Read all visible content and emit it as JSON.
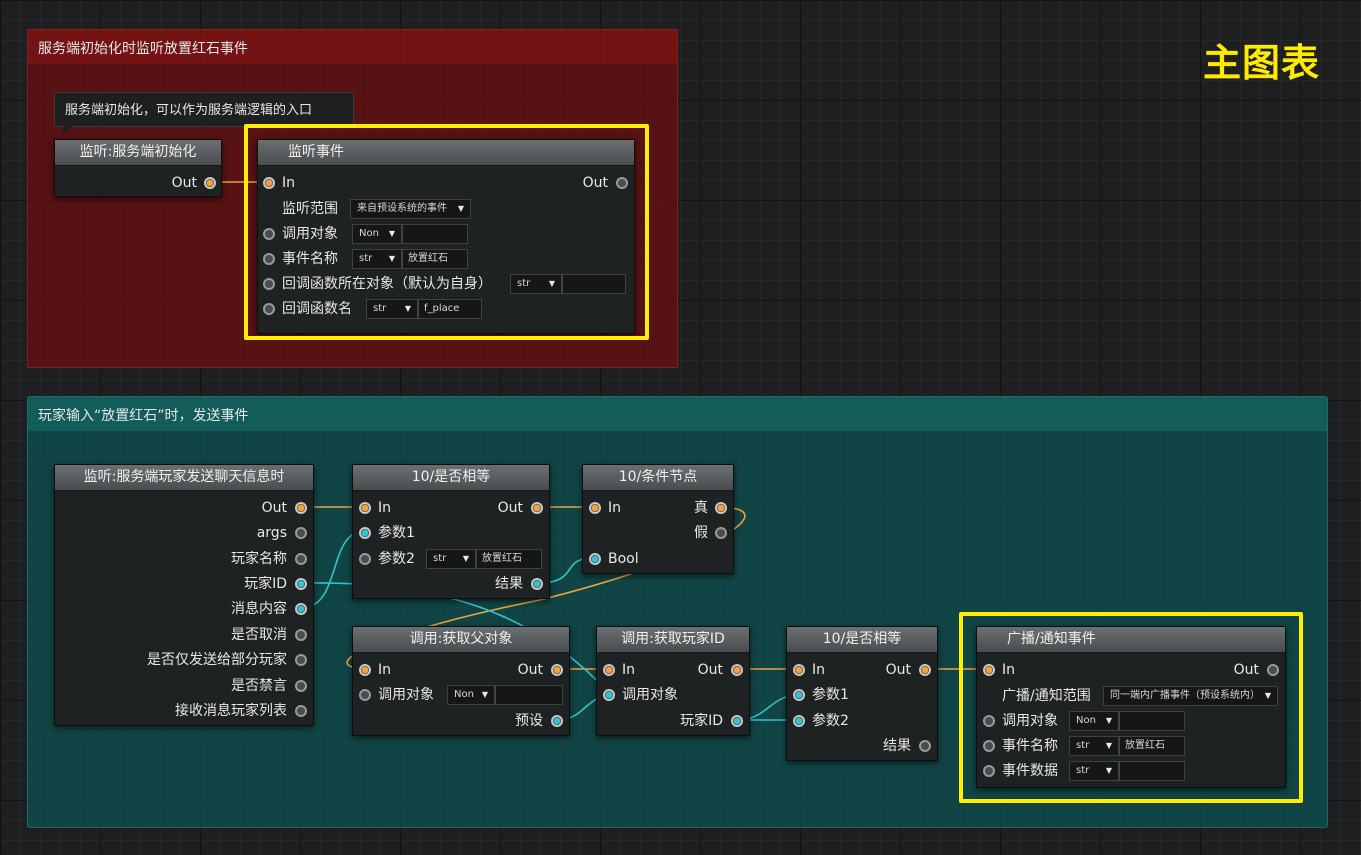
{
  "page_title": "主图表",
  "groups": {
    "server_init": {
      "title": "服务端初始化时监听放置红石事件"
    },
    "player_input": {
      "title": "玩家输入“放置红石”时，发送事件"
    }
  },
  "comment": {
    "text": "服务端初始化，可以作为服务端逻辑的入口"
  },
  "colors": {
    "exec_wire": "#f0a040",
    "data_wire": "#35c2d0",
    "highlight": "#ffee00",
    "group_red": "#6e0e0e",
    "group_teal": "#0e5250"
  },
  "nodes": {
    "server_init": {
      "title": "监听:服务端初始化",
      "out": "Out"
    },
    "listen_event": {
      "title": "监听事件",
      "in": "In",
      "out": "Out",
      "scope_label": "监听范围",
      "scope_value": "来自预设系统的事件",
      "target_label": "调用对象",
      "target_type": "Non",
      "event_name_label": "事件名称",
      "event_name_type": "str",
      "event_name_value": "放置红石",
      "callback_obj_label": "回调函数所在对象（默认为自身）",
      "callback_obj_type": "str",
      "callback_obj_value": "",
      "callback_name_label": "回调函数名",
      "callback_name_type": "str",
      "callback_name_value": "f_place"
    },
    "chat_listener": {
      "title": "监听:服务端玩家发送聊天信息时",
      "pins": [
        "Out",
        "args",
        "玩家名称",
        "玩家ID",
        "消息内容",
        "是否取消",
        "是否仅发送给部分玩家",
        "是否禁言",
        "接收消息玩家列表"
      ]
    },
    "equal_1": {
      "title": "10/是否相等",
      "in": "In",
      "out": "Out",
      "param1": "参数1",
      "param2": "参数2",
      "param2_type": "str",
      "param2_value": "放置红石",
      "result": "结果"
    },
    "condition": {
      "title": "10/条件节点",
      "in": "In",
      "true_label": "真",
      "false_label": "假",
      "bool": "Bool"
    },
    "get_parent": {
      "title": "调用:获取父对象",
      "in": "In",
      "out": "Out",
      "target_label": "调用对象",
      "target_type": "Non",
      "preset": "预设"
    },
    "get_player_id": {
      "title": "调用:获取玩家ID",
      "in": "In",
      "out": "Out",
      "target_label": "调用对象",
      "player_id": "玩家ID"
    },
    "equal_2": {
      "title": "10/是否相等",
      "in": "In",
      "out": "Out",
      "param1": "参数1",
      "param2": "参数2",
      "result": "结果"
    },
    "broadcast": {
      "title": "广播/通知事件",
      "in": "In",
      "out": "Out",
      "scope_label": "广播/通知范围",
      "scope_value": "同一端内广播事件（预设系统内）",
      "target_label": "调用对象",
      "target_type": "Non",
      "event_name_label": "事件名称",
      "event_name_type": "str",
      "event_name_value": "放置红石",
      "event_data_label": "事件数据",
      "event_data_type": "str",
      "event_data_value": ""
    }
  }
}
